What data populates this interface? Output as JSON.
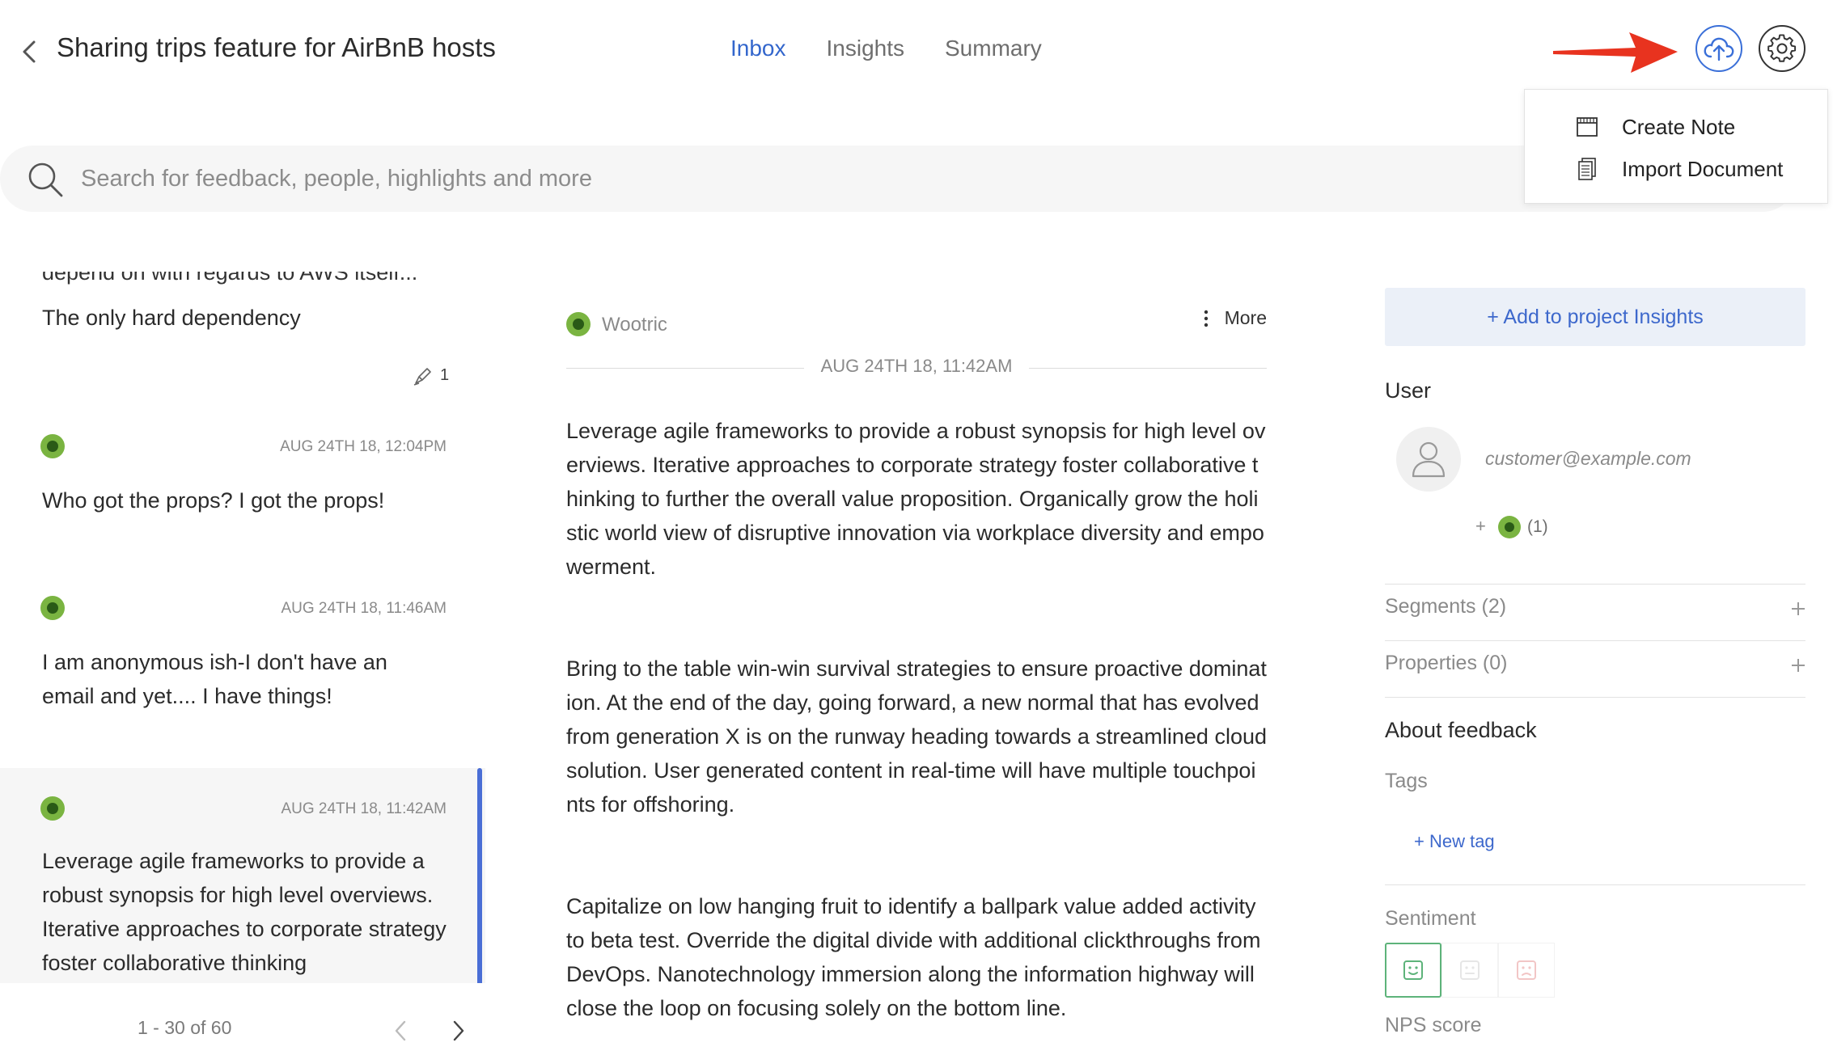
{
  "header": {
    "title": "Sharing trips feature for AirBnB hosts",
    "tabs": [
      {
        "label": "Inbox",
        "active": true
      },
      {
        "label": "Insights",
        "active": false
      },
      {
        "label": "Summary",
        "active": false
      }
    ],
    "upload_icon": "cloud-upload-icon",
    "settings_icon": "gear-icon",
    "annotation_arrow_color": "#e8331f"
  },
  "dropdown": {
    "items": [
      {
        "label": "Create Note",
        "icon": "note-icon"
      },
      {
        "label": "Import Document",
        "icon": "document-icon"
      }
    ]
  },
  "search": {
    "placeholder": "Search for feedback, people, highlights and more",
    "value": ""
  },
  "feedback_list": {
    "cut_text": "depend on with regards to AWS itself...",
    "first_item_text": "The only hard dependency",
    "first_item_highlights": "1",
    "items": [
      {
        "date": "AUG 24TH 18, 12:04PM",
        "text": "Who got the props? I got the props!",
        "selected": false
      },
      {
        "date": "AUG 24TH 18, 11:46AM",
        "text": "I am anonymous ish-I don't have an email and yet.... I have things!",
        "selected": false
      },
      {
        "date": "AUG 24TH 18, 11:42AM",
        "text": "Leverage agile frameworks to provide a robust synopsis for high level overviews. Iterative approaches to corporate strategy foster collaborative thinking",
        "selected": true
      }
    ],
    "pagination": {
      "label": "1 - 30 of 60"
    }
  },
  "detail": {
    "source": "Wootric",
    "more_label": "More",
    "date": "AUG 24TH 18, 11:42AM",
    "paragraphs": [
      "Leverage agile frameworks to provide a robust synopsis for high level  overviews. Iterative approaches to corporate strategy foster collaborative thinking to further the overall value proposition. Organically grow the holistic world view of disruptive innovation via workplace diversity  and empowerment.",
      "Bring to the table win-win survival strategies to ensure proactive domination. At the end of the day, going forward, a new normal that has evolved from generation X is on the runway heading towards a streamlined cloud solution. User generated content in real-time will have multiple touchpoints for offshoring.",
      "Capitalize on low hanging fruit to identify a ballpark value added activity to beta test. Override the digital divide with additional clickthroughs from DevOps. Nanotechnology immersion along the information highway will close the loop on focusing solely on the bottom line."
    ]
  },
  "sidebar": {
    "add_insights": "+ Add to project Insights",
    "user_heading": "User",
    "user_email": "customer@example.com",
    "user_add": "+",
    "user_source_count": "(1)",
    "segments_label": "Segments (2)",
    "properties_label": "Properties (0)",
    "about_heading": "About feedback",
    "tags_label": "Tags",
    "new_tag": "+ New tag",
    "sentiment_label": "Sentiment",
    "sentiment_selected": "positive",
    "nps_label": "NPS score"
  },
  "colors": {
    "accent": "#3366cc",
    "source_dot": "#7ab441",
    "selected_bar": "#4a6ed6",
    "positive": "#5db37a"
  }
}
